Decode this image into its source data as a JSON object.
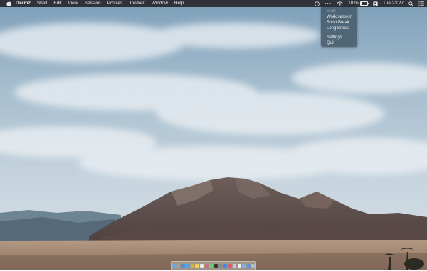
{
  "menubar": {
    "app_name": "iTerm2",
    "menus": [
      "Shell",
      "Edit",
      "View",
      "Session",
      "Profiles",
      "Toolbelt",
      "Window",
      "Help"
    ],
    "status": {
      "battery_percent": "10 %",
      "battery_level": 0.1,
      "datetime": "Tue 23:27"
    }
  },
  "dropdown": {
    "items": [
      {
        "label": "Start",
        "enabled": false
      },
      {
        "label": "Work session",
        "enabled": true
      },
      {
        "label": "Short Break",
        "enabled": true
      },
      {
        "label": "Long Break",
        "enabled": true
      },
      {
        "label": "Settings",
        "enabled": true
      },
      {
        "label": "Quit",
        "enabled": true
      }
    ]
  },
  "dock": {
    "icons": [
      "finder-icon",
      "launchpad-icon",
      "safari-icon",
      "mail-icon",
      "chrome-icon",
      "notes-icon",
      "calendar-icon",
      "photos-icon",
      "messages-icon",
      "terminal-icon",
      "system-preferences-icon",
      "app-store-icon",
      "music-icon",
      "preview-icon",
      "textedit-icon",
      "folder-icon",
      "downloads-icon",
      "trash-icon"
    ],
    "colors": [
      "#6fa8dc",
      "#9aa3ab",
      "#4a90d9",
      "#5aa0e0",
      "#e0b030",
      "#f2d35a",
      "#e8e8e8",
      "#d46a8a",
      "#6ccf6a",
      "#333333",
      "#8c8c8c",
      "#3d8ee0",
      "#e05a6a",
      "#c9c9c9",
      "#eeeeee",
      "#7fb0e6",
      "#5e95d8",
      "#b8bcc0"
    ]
  }
}
